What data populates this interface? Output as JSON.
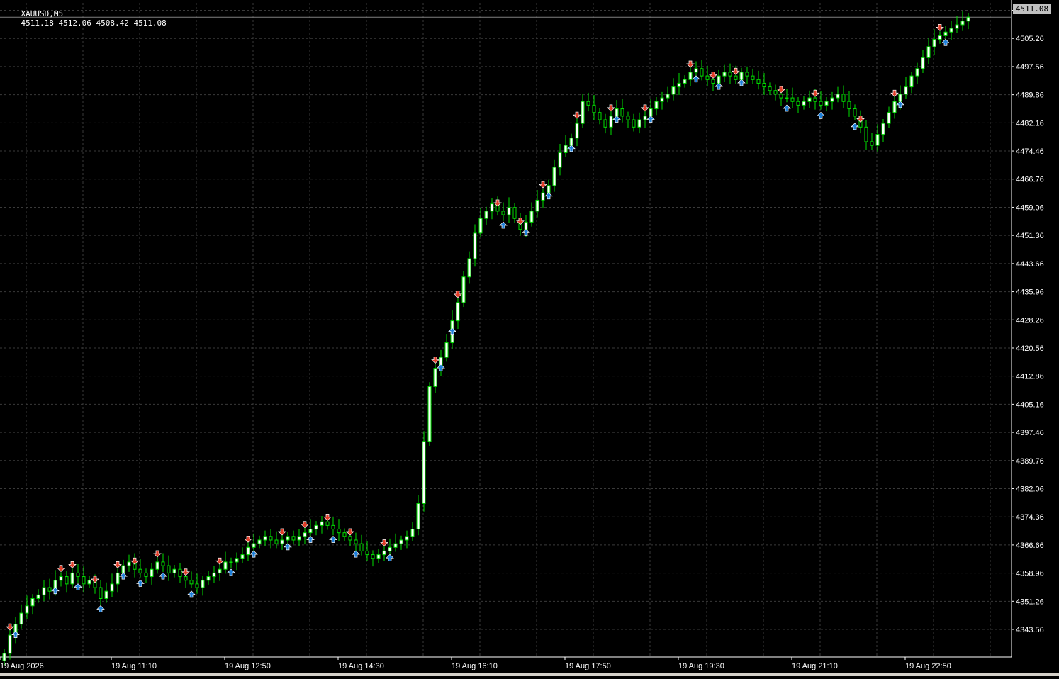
{
  "header": {
    "symbol_timeframe": "XAUUSD,M5",
    "ohlc": "4511.18 4512.06 4508.42 4511.08"
  },
  "current_price": "4511.08",
  "price_axis_labels": [
    "4512.96",
    "4505.26",
    "4497.56",
    "4489.86",
    "4482.16",
    "4474.46",
    "4466.76",
    "4459.06",
    "4451.36",
    "4443.66",
    "4435.96",
    "4428.26",
    "4420.56",
    "4412.86",
    "4405.16",
    "4397.46",
    "4389.76",
    "4382.06",
    "4374.36",
    "4366.66",
    "4358.96",
    "4351.26",
    "4343.56"
  ],
  "time_axis_labels": [
    "19 Aug 2026",
    "19 Aug 11:10",
    "19 Aug 12:50",
    "19 Aug 14:30",
    "19 Aug 16:10",
    "19 Aug 17:50",
    "19 Aug 19:30",
    "19 Aug 21:10",
    "19 Aug 22:50"
  ],
  "colors": {
    "background": "#000000",
    "grid": "#3a3a3a",
    "bull_candle": "#00e000",
    "bull_body": "#ffffff",
    "bear_candle": "#00e000",
    "bear_body": "#000000",
    "axis_text": "#ffffff",
    "buy_arrow": "#1e7fd8",
    "sell_arrow": "#e03c28",
    "price_line": "#808080"
  },
  "chart_data": {
    "type": "candlestick",
    "timeframe": "M5",
    "ylim": [
      4336.0,
      4515.0
    ],
    "close": [
      4337,
      4342,
      4345,
      4348,
      4350,
      4352,
      4353,
      4355,
      4354,
      4357,
      4358,
      4356,
      4359,
      4358,
      4356,
      4357,
      4355,
      4352,
      4354,
      4356,
      4359,
      4361,
      4362,
      4360,
      4359,
      4358,
      4360,
      4362,
      4361,
      4359,
      4360,
      4358,
      4357,
      4356,
      4355,
      4357,
      4358,
      4359,
      4360,
      4362,
      4362,
      4363,
      4364,
      4366,
      4367,
      4368,
      4369,
      4368,
      4367,
      4368,
      4369,
      4368,
      4369,
      4370,
      4371,
      4372,
      4373,
      4372,
      4371,
      4370,
      4369,
      4368,
      4367,
      4365,
      4364,
      4363,
      4364,
      4365,
      4366,
      4367,
      4368,
      4369,
      4371,
      4378,
      4395,
      4410,
      4415,
      4418,
      4422,
      4428,
      4433,
      4440,
      4445,
      4452,
      4456,
      4458,
      4460,
      4458,
      4457,
      4459,
      4456,
      4453,
      4455,
      4458,
      4461,
      4463,
      4465,
      4470,
      4474,
      4476,
      4478,
      4482,
      4488,
      4487,
      4485,
      4483,
      4481,
      4484,
      4486,
      4484,
      4483,
      4481,
      4483,
      4484,
      4486,
      4488,
      4489,
      4490,
      4492,
      4493,
      4494,
      4496,
      4497,
      4495,
      4494,
      4493,
      4495,
      4496,
      4495,
      4494,
      4496,
      4495,
      4494,
      4493,
      4492,
      4491,
      4490,
      4489,
      4489,
      4488,
      4487,
      4488,
      4489,
      4488,
      4487,
      4488,
      4489,
      4490,
      4488,
      4486,
      4484,
      4481,
      4477,
      4476,
      4479,
      4482,
      4485,
      4488,
      4490,
      4492,
      4495,
      4497,
      4500,
      4503,
      4505,
      4506,
      4507,
      4508,
      4509,
      4510,
      4511.08
    ],
    "signals": {
      "buy_arrows_index": [
        2,
        9,
        13,
        17,
        21,
        24,
        28,
        33,
        40,
        44,
        50,
        54,
        58,
        62,
        68,
        77,
        79,
        88,
        92,
        96,
        100,
        108,
        114,
        122,
        126,
        130,
        138,
        144,
        150,
        158,
        166,
        172
      ],
      "sell_arrows_index": [
        1,
        10,
        12,
        16,
        20,
        23,
        27,
        32,
        38,
        43,
        49,
        53,
        57,
        61,
        67,
        76,
        80,
        87,
        91,
        95,
        101,
        107,
        113,
        121,
        125,
        129,
        137,
        143,
        151,
        157,
        165,
        171
      ]
    }
  }
}
